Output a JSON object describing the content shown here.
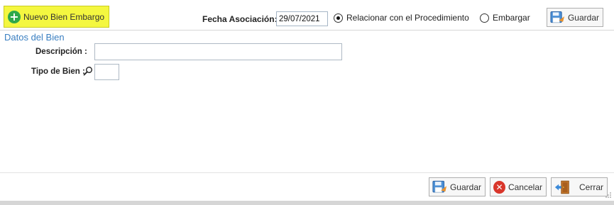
{
  "toolbar": {
    "new_button_label": "Nuevo Bien Embargo",
    "fecha_label": "Fecha Asociación:",
    "fecha_value": "29/07/2021",
    "radio_relacionar": "Relacionar con el Procedimiento",
    "radio_embargar": "Embargar",
    "selected_option": "Relacionar con el Procedimiento",
    "guardar_label": "Guardar"
  },
  "form": {
    "section_title": "Datos del Bien",
    "descripcion_label": "Descripción :",
    "descripcion_value": "",
    "tipo_label": "Tipo de Bien :",
    "tipo_value": ""
  },
  "footer": {
    "guardar_label": "Guardar",
    "cancelar_label": "Cancelar",
    "cerrar_label": "Cerrar"
  },
  "icons": {
    "new": "plus-circle-icon",
    "save": "floppy-save-icon",
    "cancel": "cancel-circle-icon",
    "close": "door-exit-icon",
    "lookup": "magnifier-icon"
  },
  "colors": {
    "highlight": "#f4f740",
    "section_title": "#3a7fc1",
    "add_green": "#2fa84a",
    "cancel_red": "#d9362b"
  }
}
